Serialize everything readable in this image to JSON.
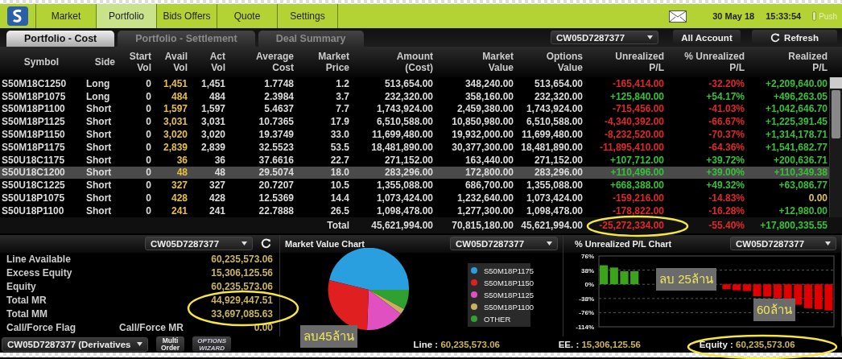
{
  "nav": {
    "items": [
      {
        "label": "Market",
        "selected": false
      },
      {
        "label": "Portfolio",
        "selected": true
      },
      {
        "label": "Bids Offers",
        "selected": false
      },
      {
        "label": "Quote",
        "selected": false
      },
      {
        "label": "Settings",
        "selected": false
      }
    ],
    "date": "30 May 18",
    "time": "15:33:54",
    "push": "Push"
  },
  "tabs": [
    {
      "label": "Portfolio - Cost",
      "selected": true
    },
    {
      "label": "Portfolio - Settlement",
      "selected": false
    },
    {
      "label": "Deal Summary",
      "selected": false
    }
  ],
  "toolbar": {
    "account": "CW05D7287377",
    "all_account": "All Account",
    "refresh": "Refresh"
  },
  "table": {
    "columns": [
      [
        "Symbol"
      ],
      [
        "Side"
      ],
      [
        "Start",
        "Vol"
      ],
      [
        "Avail",
        "Vol"
      ],
      [
        "Act",
        "Vol"
      ],
      [
        "Average",
        "Cost"
      ],
      [
        "Market",
        "Price"
      ],
      [
        "Amount",
        "(Cost)"
      ],
      [
        "Market",
        "Value"
      ],
      [
        "Options",
        "Value"
      ],
      [
        "Unrealized",
        "P/L"
      ],
      [
        "% Unrealized",
        "P/L"
      ],
      [
        "Realized",
        "P/L"
      ]
    ],
    "rows": [
      {
        "symbol": "S50M18C1250",
        "side": "Long",
        "start_vol": "0",
        "avail_vol": "1,451",
        "act_vol": "1,451",
        "avg_cost": "1.7748",
        "market_price": "1.2",
        "amount": "513,654.00",
        "market_value": "348,240.00",
        "options_value": "513,654.00",
        "unrealized": "-165,414.00",
        "unrealized_pct": "-32.20%",
        "realized": "+2,209,640.00",
        "selected": false
      },
      {
        "symbol": "S50M18P1075",
        "side": "Long",
        "start_vol": "0",
        "avail_vol": "484",
        "act_vol": "484",
        "avg_cost": "2.3984",
        "market_price": "3.7",
        "amount": "232,320.00",
        "market_value": "358,160.00",
        "options_value": "232,320.00",
        "unrealized": "+125,840.00",
        "unrealized_pct": "+54.17%",
        "realized": "+496,263.05",
        "selected": false
      },
      {
        "symbol": "S50M18P1100",
        "side": "Short",
        "start_vol": "0",
        "avail_vol": "1,597",
        "act_vol": "1,597",
        "avg_cost": "5.4637",
        "market_price": "7.7",
        "amount": "1,743,924.00",
        "market_value": "2,459,380.00",
        "options_value": "1,743,924.00",
        "unrealized": "-715,456.00",
        "unrealized_pct": "-41.03%",
        "realized": "+1,042,646.70",
        "selected": false
      },
      {
        "symbol": "S50M18P1125",
        "side": "Short",
        "start_vol": "0",
        "avail_vol": "3,031",
        "act_vol": "3,031",
        "avg_cost": "10.7365",
        "market_price": "17.9",
        "amount": "6,510,588.00",
        "market_value": "10,850,980.00",
        "options_value": "6,510,588.00",
        "unrealized": "-4,340,392.00",
        "unrealized_pct": "-66.67%",
        "realized": "+1,225,391.45",
        "selected": false
      },
      {
        "symbol": "S50M18P1150",
        "side": "Short",
        "start_vol": "0",
        "avail_vol": "3,020",
        "act_vol": "3,020",
        "avg_cost": "19.3749",
        "market_price": "33.0",
        "amount": "11,699,480.00",
        "market_value": "19,932,000.00",
        "options_value": "11,699,480.00",
        "unrealized": "-8,232,520.00",
        "unrealized_pct": "-70.37%",
        "realized": "+1,314,178.71",
        "selected": false
      },
      {
        "symbol": "S50M18P1175",
        "side": "Short",
        "start_vol": "0",
        "avail_vol": "2,839",
        "act_vol": "2,839",
        "avg_cost": "32.5523",
        "market_price": "53.5",
        "amount": "18,481,890.00",
        "market_value": "30,377,300.00",
        "options_value": "18,481,890.00",
        "unrealized": "-11,895,410.00",
        "unrealized_pct": "-64.36%",
        "realized": "+1,541,682.77",
        "selected": false
      },
      {
        "symbol": "S50U18C1175",
        "side": "Short",
        "start_vol": "0",
        "avail_vol": "36",
        "act_vol": "36",
        "avg_cost": "37.6616",
        "market_price": "22.7",
        "amount": "271,152.00",
        "market_value": "163,440.00",
        "options_value": "271,152.00",
        "unrealized": "+107,712.00",
        "unrealized_pct": "+39.72%",
        "realized": "+200,636.71",
        "selected": false
      },
      {
        "symbol": "S50U18C1200",
        "side": "Short",
        "start_vol": "0",
        "avail_vol": "48",
        "act_vol": "48",
        "avg_cost": "29.5074",
        "market_price": "18.0",
        "amount": "283,296.00",
        "market_value": "172,800.00",
        "options_value": "283,296.00",
        "unrealized": "+110,496.00",
        "unrealized_pct": "+39.00%",
        "realized": "+110,349.38",
        "selected": true
      },
      {
        "symbol": "S50U18C1225",
        "side": "Short",
        "start_vol": "0",
        "avail_vol": "327",
        "act_vol": "327",
        "avg_cost": "20.7207",
        "market_price": "10.5",
        "amount": "1,355,088.00",
        "market_value": "686,700.00",
        "options_value": "1,355,088.00",
        "unrealized": "+668,388.00",
        "unrealized_pct": "+49.32%",
        "realized": "+63,086.77",
        "selected": false
      },
      {
        "symbol": "S50U18P1075",
        "side": "Short",
        "start_vol": "0",
        "avail_vol": "428",
        "act_vol": "428",
        "avg_cost": "12.5369",
        "market_price": "14.4",
        "amount": "1,073,424.00",
        "market_value": "1,232,640.00",
        "options_value": "1,073,424.00",
        "unrealized": "-159,216.00",
        "unrealized_pct": "-14.83%",
        "realized": "0.00",
        "selected": false
      },
      {
        "symbol": "S50U18P1100",
        "side": "Short",
        "start_vol": "0",
        "avail_vol": "241",
        "act_vol": "241",
        "avg_cost": "22.7888",
        "market_price": "26.5",
        "amount": "1,098,478.00",
        "market_value": "1,277,300.00",
        "options_value": "1,098,478.00",
        "unrealized": "-178,822.00",
        "unrealized_pct": "-16.28%",
        "realized": "+12,980.00",
        "selected": false
      }
    ],
    "total": {
      "label": "Total",
      "amount": "45,621,994.00",
      "market_value": "70,815,180.00",
      "options_value": "45,621,994.00",
      "unrealized": "-25,272,334.00",
      "unrealized_pct": "-55.40%",
      "realized": "+17,800,335.55"
    }
  },
  "summary": {
    "account": "CW05D7287377",
    "items": [
      {
        "label": "Line Available",
        "value": "60,235,573.06"
      },
      {
        "label": "Excess Equity",
        "value": "15,306,125.56"
      },
      {
        "label": "Equity",
        "value": "60,235,573.06"
      },
      {
        "label": "Total MR",
        "value": "44,929,447.51"
      },
      {
        "label": "Total MM",
        "value": "33,697,085.63"
      },
      {
        "label": "Call/Force Flag",
        "sublabel": "Call/Force MR",
        "value": "0.00"
      }
    ]
  },
  "market_value_chart": {
    "title": "Market Value Chart",
    "account": "CW05D7287377",
    "legend": [
      {
        "label": "S50M18P1175",
        "color": "#2a9fe0"
      },
      {
        "label": "S50M18P1150",
        "color": "#e02020"
      },
      {
        "label": "S50M18P1125",
        "color": "#e050c0"
      },
      {
        "label": "S50M18P1100",
        "color": "#c8b060"
      },
      {
        "label": "OTHER",
        "color": "#30a030"
      }
    ],
    "note": "ลบ45ล้าน"
  },
  "pl_chart": {
    "title": "% Unrealized P/L Chart",
    "account": "CW05D7287377",
    "notes": [
      "ลบ 25ล้าน",
      "60ล้าน"
    ],
    "chart_data": {
      "type": "bar",
      "grid": true,
      "ylim": [
        -114,
        76
      ],
      "yticks": [
        {
          "value": 76,
          "label": "76%"
        },
        {
          "value": 38,
          "label": "38%"
        },
        {
          "value": 0,
          "label": "0%"
        },
        {
          "value": -38,
          "label": "-38%"
        },
        {
          "value": -76,
          "label": "-76%"
        },
        {
          "value": -114,
          "label": "-114%"
        }
      ],
      "values": [
        51,
        45,
        35,
        35,
        null,
        null,
        null,
        null,
        null,
        null,
        null,
        null,
        -13,
        -16,
        -18,
        -32,
        -33,
        -37,
        -41,
        -55,
        -64,
        -67,
        -70
      ]
    }
  },
  "footer": {
    "account": "CW05D7287377 (Derivatives",
    "multi_order": [
      "Multi",
      "Order"
    ],
    "wizard": [
      "OPTIONS",
      "WIZARD"
    ],
    "stats": [
      {
        "label": "Line :",
        "value": "60,235,573.06"
      },
      {
        "label": "EE. :",
        "value": "15,306,125.56"
      },
      {
        "label": "Equity :",
        "value": "60,235,573.06"
      }
    ]
  }
}
